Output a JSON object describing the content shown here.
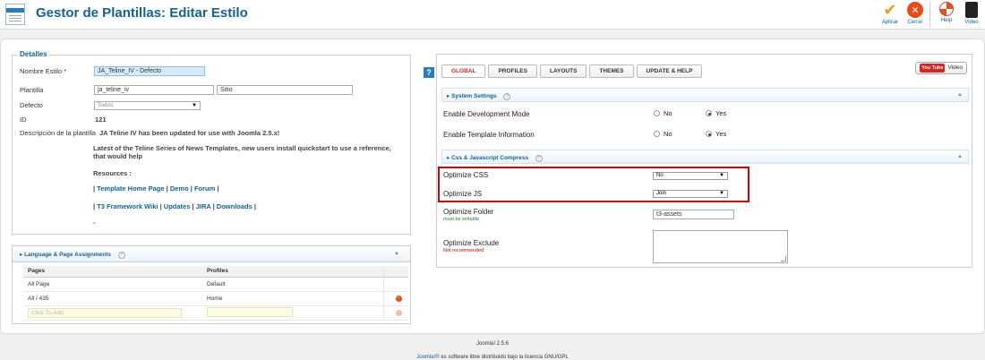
{
  "header": {
    "title": "Gestor de Plantillas: Editar Estilo",
    "toolbar": {
      "apply_label": "Aplicar",
      "close_label": "Cerrar",
      "help_label": "Help",
      "video_label": "Video"
    }
  },
  "details": {
    "legend": "Detalles",
    "style_name_label": "Nombre Estilo",
    "required_mark": "*",
    "style_name_value": "JA_Teline_IV - Defecto",
    "template_label": "Plantilla",
    "template_value": "ja_teline_iv",
    "site_value": "Sitio",
    "default_label": "Defecto",
    "default_value": "Todos",
    "id_label": "ID",
    "id_value": "121",
    "description_label": "Descripción de la plantilla",
    "description_line1": "JA Teline IV has been updated for use with Joomla 2.5.x!",
    "description_line2": "Latest of the Teline Series of News Templates, new users install quickstart to use a reference, that would help",
    "resources_label": "Resources :",
    "links_row1": [
      "Template Home Page",
      "Demo",
      "Forum"
    ],
    "links_row2": [
      "T3 Framework Wiki",
      "Updates",
      "JIRA",
      "Downloads"
    ],
    "sep": "|",
    "tail": "-"
  },
  "assignments": {
    "title": "Language & Page Assignments",
    "help_mark": "?",
    "headers": [
      "Pages",
      "Profiles"
    ],
    "rows": [
      {
        "page": "All Page",
        "profile": "Default"
      },
      {
        "page": "All / 435",
        "profile": "Home"
      }
    ],
    "add_placeholder": "Click To Add"
  },
  "right": {
    "help_mark": "?",
    "tabs": [
      "GLOBAL",
      "PROFILES",
      "LAYOUTS",
      "THEMES",
      "UPDATE & HELP"
    ],
    "yt_badge": "You Tube",
    "video_label": "Video",
    "system_settings": "System Settings",
    "dev_mode_label": "Enable Development Mode",
    "template_info_label": "Enable Template Information",
    "no": "No",
    "yes": "Yes",
    "css_js_section": "Css & Javascript Compress",
    "optimize_css_label": "Optimize CSS",
    "optimize_css_value": "No",
    "optimize_js_label": "Optimize JS",
    "optimize_js_value": "Join",
    "optimize_folder_label": "Optimize Folder",
    "optimize_folder_note": "must be writable",
    "optimize_folder_value": "t3-assets",
    "optimize_exclude_label": "Optimize Exclude",
    "optimize_exclude_note": "Not recommended"
  },
  "footer": {
    "version": "Joomla! 2.5.6",
    "license_link": "Joomla!®",
    "license_text": " es software libre distribuido bajo la licencia GNU/GPL"
  }
}
